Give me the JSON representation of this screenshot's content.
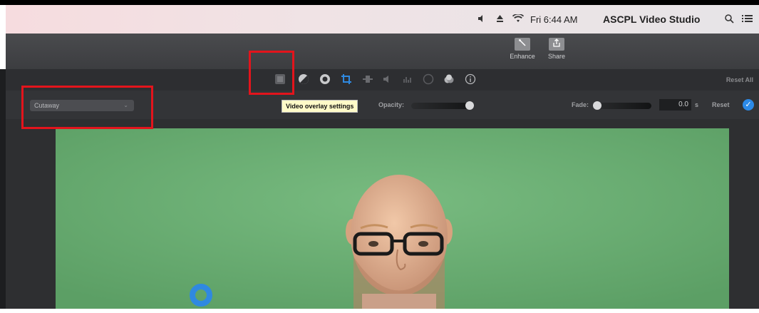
{
  "menubar": {
    "volume_icon": "volume-icon",
    "eject_icon": "eject-icon",
    "wifi_icon": "wifi-icon",
    "clock": "Fri 6:44 AM",
    "app_name": "ASCPL Video Studio",
    "search_icon": "search-icon",
    "list_icon": "list-icon"
  },
  "toolbar": {
    "enhance_label": "Enhance",
    "share_label": "Share"
  },
  "adjustments": {
    "tools": [
      "video-overlay",
      "color-balance",
      "color-correction",
      "crop",
      "stabilization",
      "volume",
      "noise-reduction",
      "speed",
      "clip-filter",
      "clip-info"
    ],
    "reset_all_label": "Reset All"
  },
  "overlay_settings": {
    "mode": "Cutaway",
    "tooltip": "Video overlay settings",
    "opacity_label": "Opacity:",
    "opacity_value": 1.0,
    "fade_label": "Fade:",
    "fade_value": "0.0",
    "fade_unit": "s",
    "reset_label": "Reset"
  },
  "colors": {
    "annotation_red": "#e3141c",
    "green_screen": "#64a86d",
    "accent_blue": "#2c8ae8"
  }
}
